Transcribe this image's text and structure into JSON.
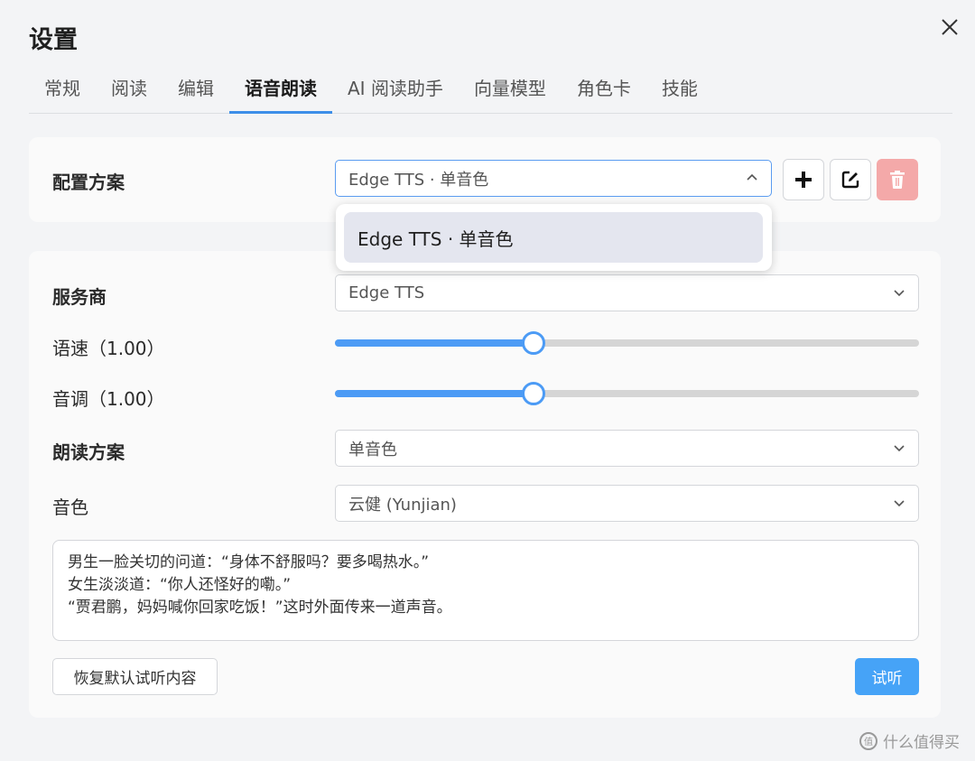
{
  "window": {
    "title": "设置"
  },
  "tabs": [
    {
      "label": "常规"
    },
    {
      "label": "阅读"
    },
    {
      "label": "编辑"
    },
    {
      "label": "语音朗读",
      "active": true
    },
    {
      "label": "AI 阅读助手"
    },
    {
      "label": "向量模型"
    },
    {
      "label": "角色卡"
    },
    {
      "label": "技能"
    }
  ],
  "profile": {
    "label": "配置方案",
    "selected": "Edge TTS · 单音色",
    "options": [
      "Edge TTS · 单音色"
    ],
    "icons": [
      "plus-icon",
      "edit-icon",
      "trash-icon"
    ]
  },
  "provider": {
    "label": "服务商",
    "value": "Edge TTS"
  },
  "rate": {
    "label": "语速（1.00）",
    "fraction": 0.34
  },
  "pitch": {
    "label": "音调（1.00）",
    "fraction": 0.34
  },
  "scheme": {
    "label": "朗读方案",
    "value": "单音色"
  },
  "voice": {
    "label": "音色",
    "value": "云健 (Yunjian)"
  },
  "preview_text": "男生一脸关切的问道：“身体不舒服吗？要多喝热水。”\n女生淡淡道：“你人还怪好的嘞。”\n“贾君鹏，妈妈喊你回家吃饭！”这时外面传来一道声音。",
  "buttons": {
    "reset": "恢复默认试听内容",
    "listen": "试听"
  },
  "watermark": {
    "text": "什么值得买"
  },
  "colors": {
    "accent": "#4c9bf5",
    "danger": "#f4a9a9",
    "primary_button": "#46a3f7"
  }
}
